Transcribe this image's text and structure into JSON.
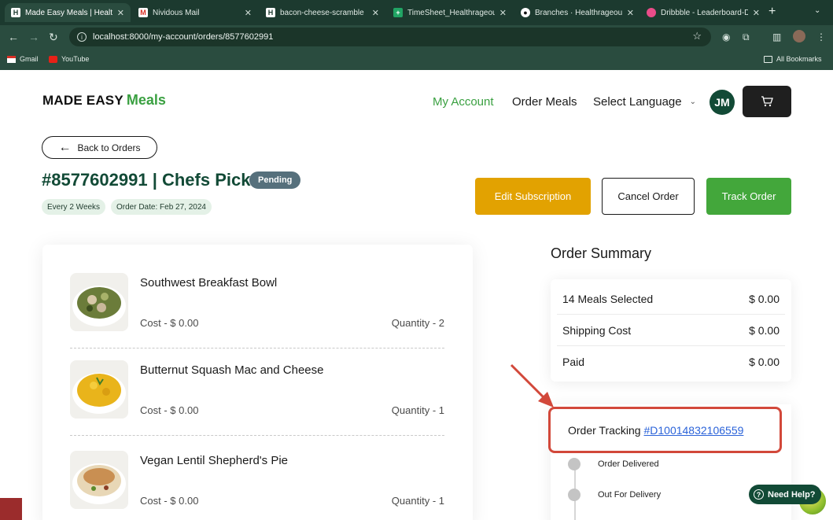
{
  "browser": {
    "tabs": [
      {
        "title": "Made Easy Meals | Health",
        "icon": "made-easy-favicon"
      },
      {
        "title": "Nividous Mail",
        "icon": "gmail-favicon"
      },
      {
        "title": "bacon-cheese-scramble",
        "icon": "made-easy-favicon"
      },
      {
        "title": "TimeSheet_Healthrageous",
        "icon": "sheets-favicon"
      },
      {
        "title": "Branches · Healthrageous",
        "icon": "github-favicon"
      },
      {
        "title": "Dribbble - Leaderboard-D",
        "icon": "dribbble-favicon"
      }
    ],
    "url": "localhost:8000/my-account/orders/8577602991",
    "bookmarks": [
      "Gmail",
      "YouTube"
    ],
    "all_bookmarks": "All Bookmarks"
  },
  "header": {
    "logo_main": "MADE EASY",
    "logo_accent": "Meals",
    "nav": [
      "My Account",
      "Order Meals"
    ],
    "language": "Select Language",
    "avatar_initials": "JM"
  },
  "order": {
    "back_label": "Back to Orders",
    "title": "#8577602991 | Chefs Pick",
    "status": "Pending",
    "frequency": "Every 2 Weeks",
    "order_date": "Order Date: Feb 27, 2024",
    "actions": {
      "edit": "Edit Subscription",
      "cancel": "Cancel Order",
      "track": "Track Order"
    },
    "items": [
      {
        "name": "Southwest Breakfast Bowl",
        "cost": "Cost - $ 0.00",
        "quantity": "Quantity - 2"
      },
      {
        "name": "Butternut Squash Mac and Cheese",
        "cost": "Cost - $ 0.00",
        "quantity": "Quantity - 1"
      },
      {
        "name": "Vegan Lentil Shepherd's Pie",
        "cost": "Cost - $ 0.00",
        "quantity": "Quantity - 1"
      }
    ]
  },
  "summary": {
    "title": "Order Summary",
    "rows": [
      {
        "label": "14 Meals Selected",
        "value": "$ 0.00"
      },
      {
        "label": "Shipping Cost",
        "value": "$ 0.00"
      },
      {
        "label": "Paid",
        "value": "$ 0.00"
      }
    ]
  },
  "tracking": {
    "label": "Order Tracking",
    "number": "#D10014832106559",
    "steps": [
      "Order Delivered",
      "Out For Delivery"
    ]
  },
  "help": {
    "label": "Need Help?"
  },
  "colors": {
    "brand_green": "#124a36",
    "accent_green": "#3aa041",
    "edit_yellow": "#e2a201",
    "track_green": "#43a73b",
    "status_slate": "#56707c",
    "highlight_red": "#d2483a"
  }
}
